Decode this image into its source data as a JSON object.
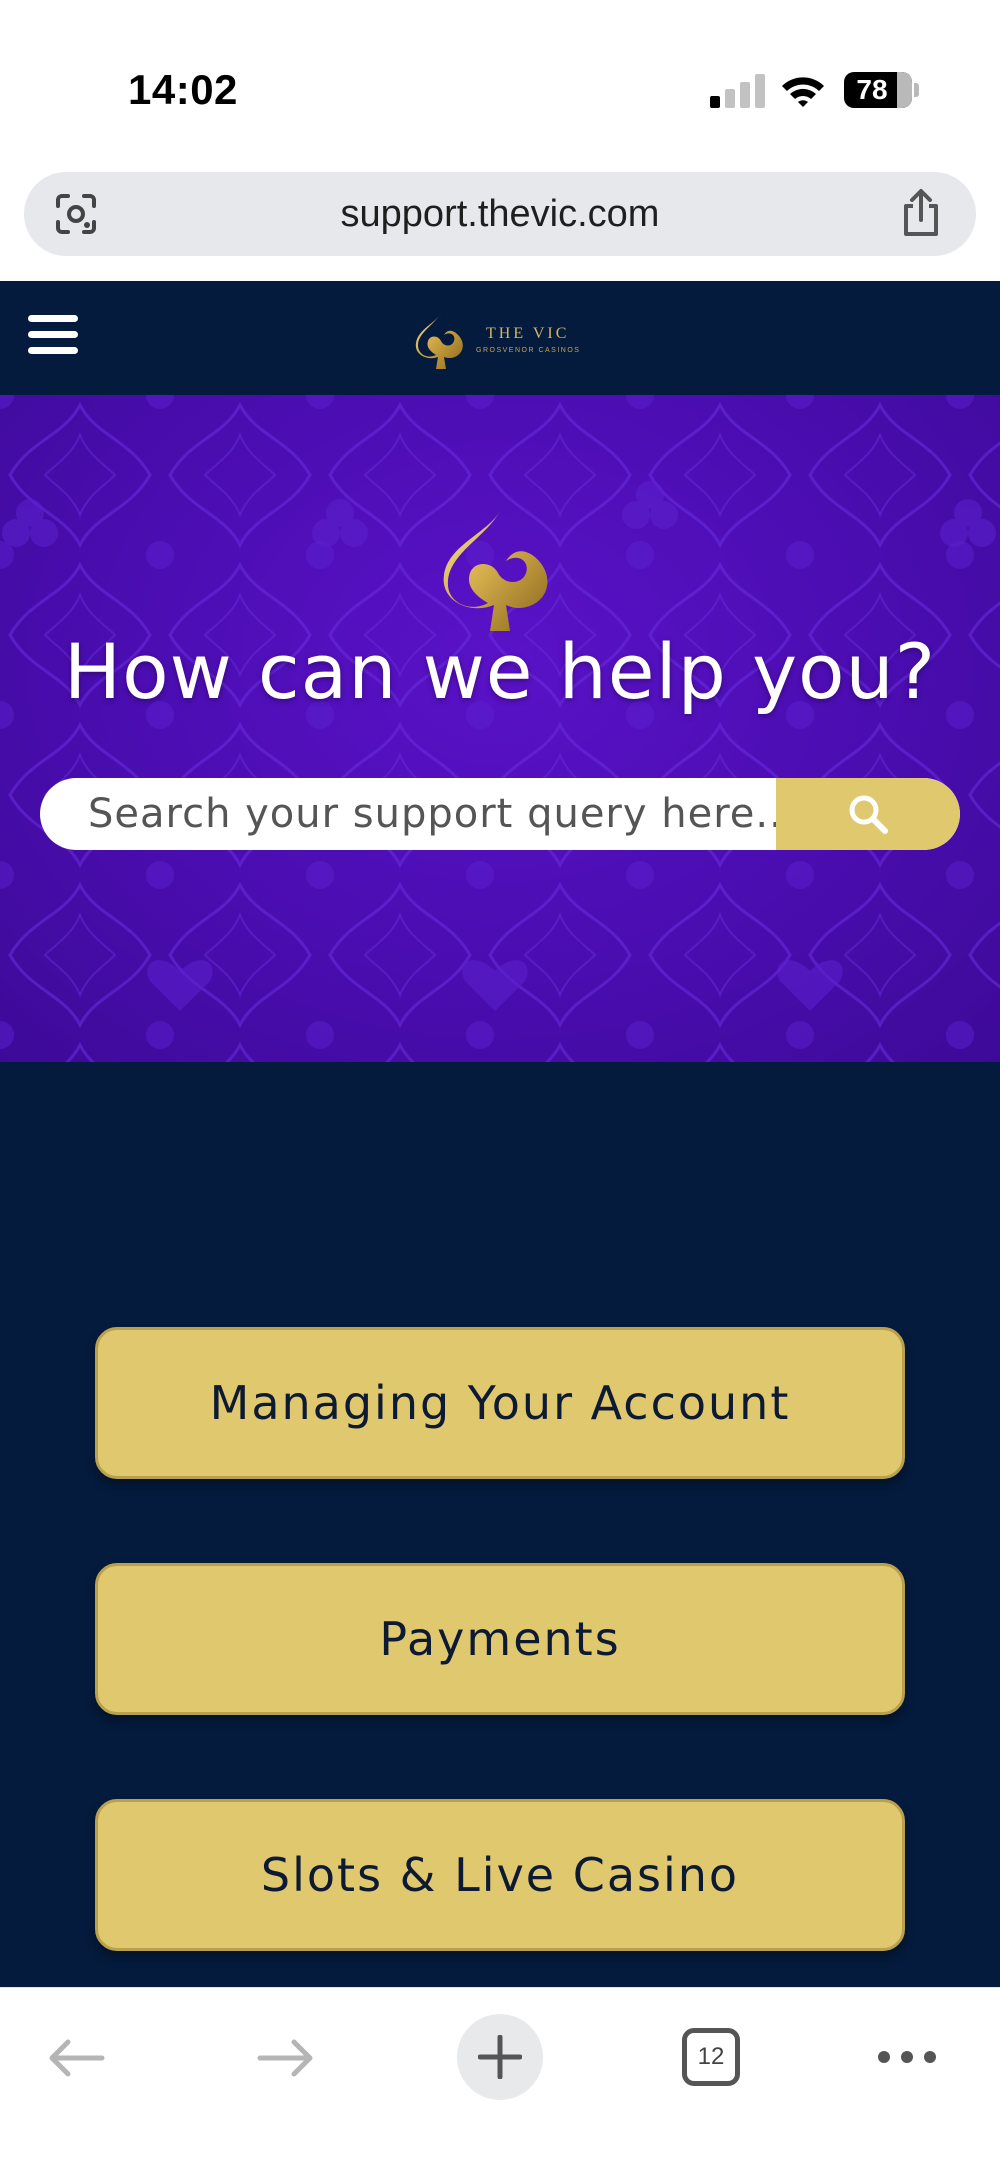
{
  "status_bar": {
    "time": "14:02",
    "battery": "78",
    "battery_level": 0.78
  },
  "browser": {
    "url": "support.thevic.com",
    "icons": [
      "lens-icon",
      "share-icon"
    ]
  },
  "site_header": {
    "logo_name": "THE VIC",
    "logo_subtitle": "GROSVENOR CASINOS",
    "menu_icon": "hamburger-menu-icon"
  },
  "hero": {
    "title": "How can we help you?",
    "search_placeholder": "Search your support query here...",
    "search_icon": "search-icon"
  },
  "categories": [
    {
      "label": "Managing Your Account"
    },
    {
      "label": "Payments"
    },
    {
      "label": "Slots & Live Casino"
    }
  ],
  "toolbar": {
    "tab_count": "12",
    "icons": [
      "back-arrow-icon",
      "forward-arrow-icon",
      "new-tab-plus-icon",
      "tabs-icon",
      "more-icon"
    ]
  },
  "colors": {
    "navy": "#041b3d",
    "purple": "#4a0db0",
    "gold": "#e0c86e"
  }
}
